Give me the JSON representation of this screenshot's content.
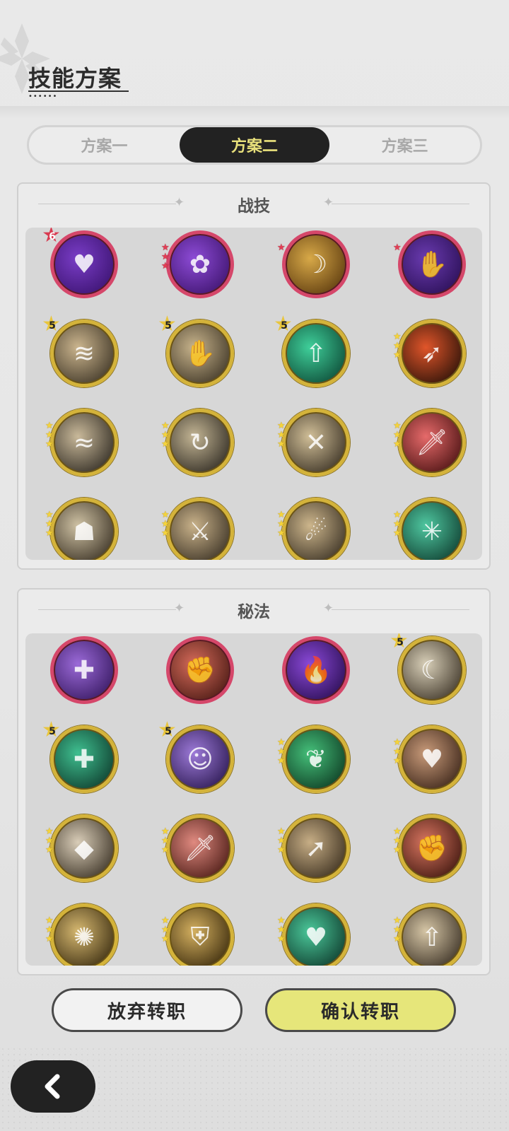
{
  "header": {
    "title": "技能方案",
    "logo_icon": "snowflake-emblem-icon"
  },
  "tabs": [
    {
      "label": "方案一",
      "active": false
    },
    {
      "label": "方案二",
      "active": true
    },
    {
      "label": "方案三",
      "active": false
    }
  ],
  "colors": {
    "tab_active_bg": "#222222",
    "tab_active_text": "#e8e07b",
    "confirm_bg": "#e6e67a",
    "gold_ring": "#d4b33a",
    "red_ring": "#d5476a"
  },
  "sections": [
    {
      "title": "战技",
      "skills": [
        {
          "icon": "purple-heart-burst-icon",
          "ring": "red",
          "badge": "6",
          "stars": 0,
          "star_color": "red",
          "fill": [
            "#7a3dc7",
            "#3b1370"
          ],
          "glyph": "♥"
        },
        {
          "icon": "purple-roses-icon",
          "ring": "red",
          "badge": "",
          "stars": 3,
          "star_color": "red",
          "fill": [
            "#8d4bd6",
            "#3e146e"
          ],
          "glyph": "✿"
        },
        {
          "icon": "golden-slash-icon",
          "ring": "red",
          "badge": "",
          "stars": 1,
          "star_color": "red",
          "fill": [
            "#d8a948",
            "#5c3a0e"
          ],
          "glyph": "☽"
        },
        {
          "icon": "dark-claw-icon",
          "ring": "red",
          "badge": "",
          "stars": 1,
          "star_color": "red",
          "fill": [
            "#6a3bb0",
            "#2a0f55"
          ],
          "glyph": "✋"
        },
        {
          "icon": "whirlwind-icon",
          "ring": "gold",
          "badge": "5",
          "stars": 0,
          "star_color": "gold",
          "fill": [
            "#cbb58e",
            "#3e3526"
          ],
          "glyph": "≋"
        },
        {
          "icon": "palm-strike-icon",
          "ring": "gold",
          "badge": "5",
          "stars": 0,
          "star_color": "gold",
          "fill": [
            "#c8b48c",
            "#3e3526"
          ],
          "glyph": "✋"
        },
        {
          "icon": "green-arrows-icon",
          "ring": "gold",
          "badge": "5",
          "stars": 0,
          "star_color": "gold",
          "fill": [
            "#3fcf9a",
            "#0d4a36"
          ],
          "glyph": "⇧"
        },
        {
          "icon": "fire-slash-icon",
          "ring": "gold",
          "badge": "",
          "stars": 3,
          "star_color": "gold",
          "fill": [
            "#e0552a",
            "#2a1208"
          ],
          "glyph": "➶"
        },
        {
          "icon": "wind-slash-icon",
          "ring": "gold",
          "badge": "",
          "stars": 3,
          "star_color": "gold",
          "fill": [
            "#c9b99a",
            "#2f2a22"
          ],
          "glyph": "≈"
        },
        {
          "icon": "spin-slash-icon",
          "ring": "gold",
          "badge": "",
          "stars": 3,
          "star_color": "gold",
          "fill": [
            "#c3b594",
            "#2f2a22"
          ],
          "glyph": "↻"
        },
        {
          "icon": "ground-spikes-icon",
          "ring": "gold",
          "badge": "",
          "stars": 3,
          "star_color": "gold",
          "fill": [
            "#d1bf98",
            "#3a3124"
          ],
          "glyph": "✕"
        },
        {
          "icon": "red-warrior-icon",
          "ring": "gold",
          "badge": "",
          "stars": 3,
          "star_color": "gold",
          "fill": [
            "#e66a6a",
            "#4a1212"
          ],
          "glyph": "🗡"
        },
        {
          "icon": "shadow-clones-icon",
          "ring": "gold",
          "badge": "",
          "stars": 3,
          "star_color": "gold",
          "fill": [
            "#cfc2a4",
            "#3a3124"
          ],
          "glyph": "☗"
        },
        {
          "icon": "sword-thrust-icon",
          "ring": "gold",
          "badge": "",
          "stars": 3,
          "star_color": "gold",
          "fill": [
            "#c9b28a",
            "#3a3124"
          ],
          "glyph": "⚔"
        },
        {
          "icon": "leap-attack-icon",
          "ring": "gold",
          "badge": "",
          "stars": 3,
          "star_color": "gold",
          "fill": [
            "#cdb68c",
            "#3a3124"
          ],
          "glyph": "☄"
        },
        {
          "icon": "web-trap-icon",
          "ring": "gold",
          "badge": "",
          "stars": 3,
          "star_color": "gold",
          "fill": [
            "#4fc7a0",
            "#0f3e30"
          ],
          "glyph": "✳"
        }
      ]
    },
    {
      "title": "秘法",
      "skills": [
        {
          "icon": "purple-orb-heal-icon",
          "ring": "red",
          "badge": "",
          "stars": 0,
          "star_color": "red",
          "fill": [
            "#9b6ad8",
            "#361860"
          ],
          "glyph": "✚"
        },
        {
          "icon": "red-fist-icon",
          "ring": "red",
          "badge": "",
          "stars": 0,
          "star_color": "red",
          "fill": [
            "#d66b5a",
            "#4a1a14"
          ],
          "glyph": "✊"
        },
        {
          "icon": "purple-flame-icon",
          "ring": "red",
          "badge": "",
          "stars": 0,
          "star_color": "red",
          "fill": [
            "#8a49d8",
            "#2a0e52"
          ],
          "glyph": "🔥"
        },
        {
          "icon": "moon-leaf-icon",
          "ring": "gold",
          "badge": "5",
          "stars": 0,
          "star_color": "gold",
          "fill": [
            "#d8cfb8",
            "#3e3528"
          ],
          "glyph": "☾"
        },
        {
          "icon": "green-heal-plus-icon",
          "ring": "gold",
          "badge": "5",
          "stars": 0,
          "star_color": "gold",
          "fill": [
            "#3fbf90",
            "#0e3b2c"
          ],
          "glyph": "✚"
        },
        {
          "icon": "purple-aura-figure-icon",
          "ring": "gold",
          "badge": "5",
          "stars": 0,
          "star_color": "gold",
          "fill": [
            "#9d7ad8",
            "#2a1850"
          ],
          "glyph": "☺"
        },
        {
          "icon": "green-leaf-blade-icon",
          "ring": "gold",
          "badge": "",
          "stars": 3,
          "star_color": "gold",
          "fill": [
            "#45c07a",
            "#0d3a22"
          ],
          "glyph": "❦"
        },
        {
          "icon": "heart-shield-icon",
          "ring": "gold",
          "badge": "",
          "stars": 3,
          "star_color": "gold",
          "fill": [
            "#c99b7a",
            "#3a2418"
          ],
          "glyph": "♥"
        },
        {
          "icon": "crystal-shard-icon",
          "ring": "gold",
          "badge": "",
          "stars": 3,
          "star_color": "gold",
          "fill": [
            "#d9cdb8",
            "#3a3124"
          ],
          "glyph": "◆"
        },
        {
          "icon": "red-sword-heal-icon",
          "ring": "gold",
          "badge": "",
          "stars": 3,
          "star_color": "gold",
          "fill": [
            "#e08a80",
            "#4a1a14"
          ],
          "glyph": "🗡"
        },
        {
          "icon": "bird-strike-icon",
          "ring": "gold",
          "badge": "",
          "stars": 3,
          "star_color": "gold",
          "fill": [
            "#c7ae86",
            "#3a2e1e"
          ],
          "glyph": "➚"
        },
        {
          "icon": "red-fist-wrap-icon",
          "ring": "gold",
          "badge": "",
          "stars": 3,
          "star_color": "gold",
          "fill": [
            "#d87560",
            "#3e160e"
          ],
          "glyph": "✊"
        },
        {
          "icon": "golden-vortex-icon",
          "ring": "gold",
          "badge": "",
          "stars": 3,
          "star_color": "gold",
          "fill": [
            "#d6b870",
            "#3a2c10"
          ],
          "glyph": "✺"
        },
        {
          "icon": "golden-armor-icon",
          "ring": "gold",
          "badge": "",
          "stars": 3,
          "star_color": "gold",
          "fill": [
            "#d4b060",
            "#3a2a0c"
          ],
          "glyph": "⛨"
        },
        {
          "icon": "green-heart-heal-icon",
          "ring": "gold",
          "badge": "",
          "stars": 3,
          "star_color": "gold",
          "fill": [
            "#4bc89a",
            "#0e3a2c"
          ],
          "glyph": "♥"
        },
        {
          "icon": "sword-upgrade-icon",
          "ring": "gold",
          "badge": "",
          "stars": 3,
          "star_color": "gold",
          "fill": [
            "#d6c6a6",
            "#3a3024"
          ],
          "glyph": "⇧"
        }
      ]
    }
  ],
  "buttons": {
    "abandon_label": "放弃转职",
    "confirm_label": "确认转职",
    "back_icon": "chevron-left-icon"
  }
}
